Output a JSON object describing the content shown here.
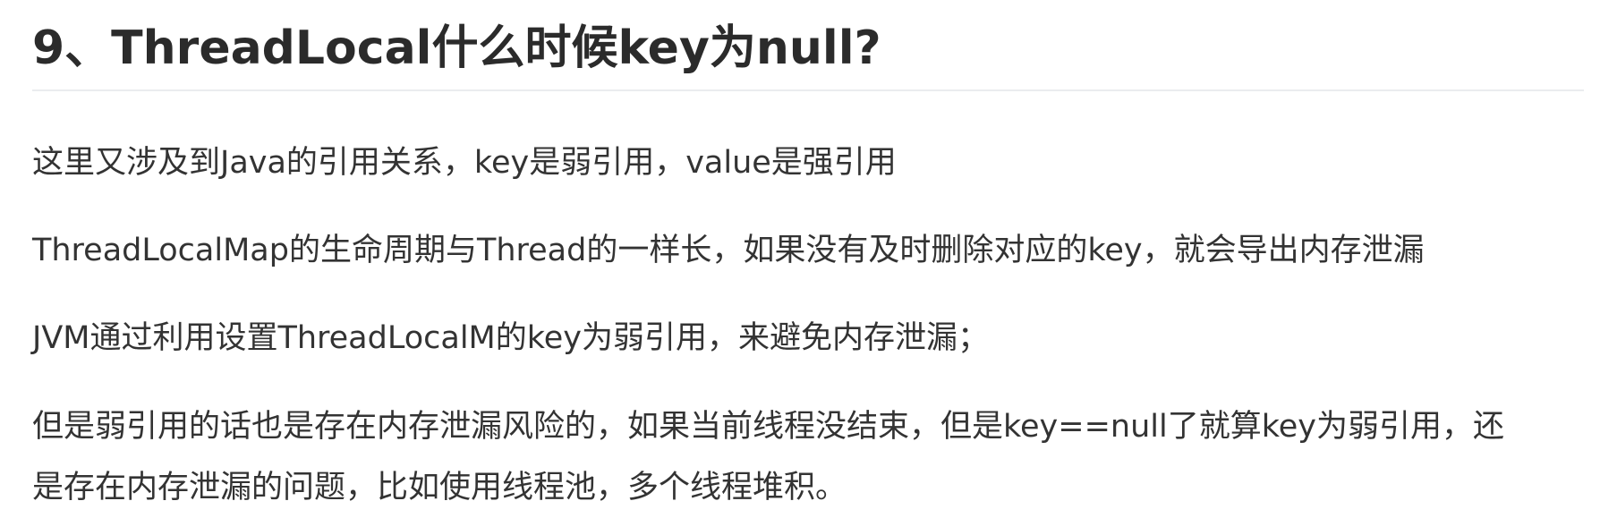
{
  "article": {
    "heading": "9、ThreadLocal什么时候key为null?",
    "paragraphs": [
      "这里又涉及到Java的引用关系，key是弱引用，value是强引用",
      "ThreadLocalMap的生命周期与Thread的一样长，如果没有及时删除对应的key，就会导出内存泄漏",
      "JVM通过利用设置ThreadLocalM的key为弱引用，来避免内存泄漏；"
    ],
    "last_paragraph_lines": [
      "但是弱引用的话也是存在内存泄漏风险的，如果当前线程没结束，但是key==null了就算key为弱引用，还",
      "是存在内存泄漏的问题，比如使用线程池，多个线程堆积。"
    ]
  }
}
